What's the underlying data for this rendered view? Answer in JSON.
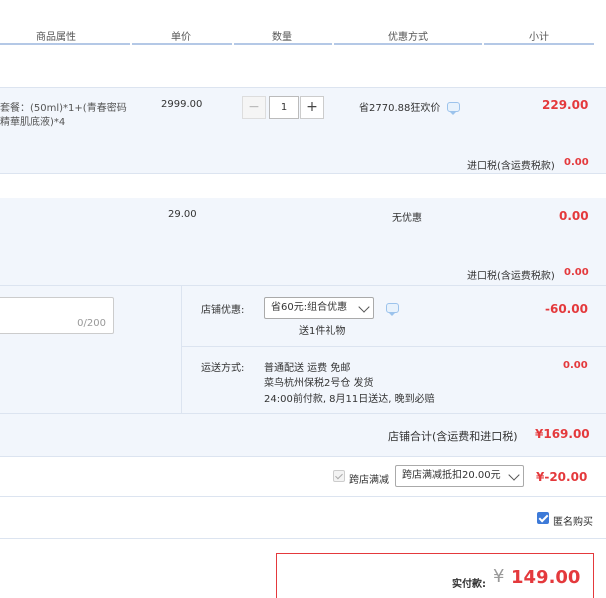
{
  "header": {
    "cols": {
      "attr": "商品属性",
      "unit_price": "单价",
      "qty": "数量",
      "promo": "优惠方式",
      "subtotal": "小计"
    }
  },
  "items": [
    {
      "name_line1": "套餐：(50ml)*1+(青春密码",
      "name_line2": "精華肌底液)*4",
      "unit_price": "2999.00",
      "qty": "1",
      "promo": "省2770.88狂欢价",
      "subtotal": "229.00",
      "tax_label": "进口税(含运费税款)",
      "tax_value": "0.00"
    },
    {
      "unit_price": "29.00",
      "promo": "无优惠",
      "subtotal": "0.00",
      "tax_label": "进口税(含运费税款)",
      "tax_value": "0.00"
    }
  ],
  "store": {
    "memo_count": "0/200",
    "discount_label": "店铺优惠:",
    "discount_select": "省60元:组合优惠",
    "gift": "送1件礼物",
    "discount_value": "-60.00",
    "shipping_label": "运送方式:",
    "shipping_line1": "普通配送 运费 免邮",
    "shipping_line2": "菜鸟杭州保税2号仓   发货",
    "shipping_line3": "24:00前付款, 8月11日送达, 晚到必赔",
    "shipping_value": "0.00",
    "total_label": "店铺合计(含运费和进口税)",
    "total_value": "¥169.00"
  },
  "cross_store": {
    "label": "跨店满减",
    "select": "跨店满减抵扣20.00元",
    "value": "¥-20.00"
  },
  "anonymous": {
    "label": "匿名购买"
  },
  "payment": {
    "label": "实付款:",
    "currency": "¥",
    "amount": "149.00"
  },
  "colors": {
    "accent_red": "#e4393c",
    "header_blue": "#b4c8e6",
    "row_blue": "#f2f6fc",
    "checkbox_blue": "#3d7ad8"
  },
  "icons": [
    "minus-icon",
    "plus-icon",
    "chat-icon",
    "chevron-down-icon",
    "checkbox-icon"
  ]
}
